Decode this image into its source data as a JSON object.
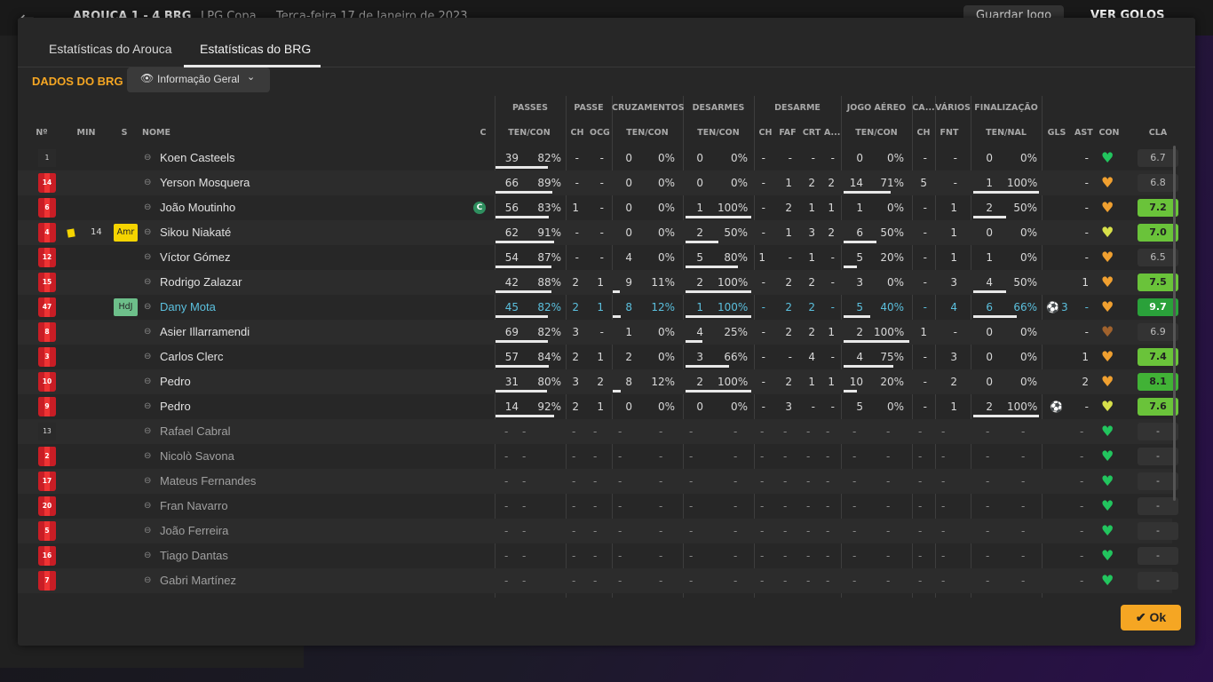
{
  "topbar": {
    "score": "AROUCA   1 - 4   BRG",
    "competition": "LPG Copa",
    "date": "Terça-feira 17 de Janeiro de 2023",
    "save": "Guardar Jogo",
    "goals": "VER GOLOS"
  },
  "tabs": [
    {
      "label": "Estatísticas do Arouca"
    },
    {
      "label": "Estatísticas do BRG"
    }
  ],
  "subtitle": "DADOS DO BRG",
  "view_dropdown": {
    "label": "Informação Geral"
  },
  "groups": [
    "PASSES",
    "PASSE",
    "CRUZAMENTOS",
    "DESARMES",
    "DESARME",
    "JOGO AÉREO",
    "CA...",
    "VÁRIOS",
    "FINALIZAÇÃO"
  ],
  "columns": [
    "Nº",
    "MIN",
    "S",
    "NOME",
    "C",
    "TEN/CON",
    "CH",
    "OCG",
    "TEN/CON",
    "TEN/CON",
    "CH",
    "FAF",
    "CRT",
    "A...",
    "TEN/CON",
    "CH",
    "FNT",
    "TEN/NAL",
    "GLS",
    "AST",
    "CON",
    "CLA"
  ],
  "rows": [
    {
      "no": "1",
      "gk": true,
      "min": "",
      "pos": "",
      "name": "Koen Casteels",
      "cap": "",
      "pt": "39",
      "pp": "82%",
      "pch": "-",
      "pocg": "-",
      "ct": "0",
      "cp": "0%",
      "dt": "0",
      "dp": "0%",
      "dch": "-",
      "faf": "-",
      "crt": "-",
      "a": "-",
      "at": "0",
      "ap": "0%",
      "ca": "-",
      "fnt": "-",
      "ft": "0",
      "fp": "0%",
      "gls": "",
      "ast": "-",
      "rating": "6.7",
      "r": 1,
      "heart": "#22c55e",
      "yc": false
    },
    {
      "no": "14",
      "min": "",
      "pos": "",
      "name": "Yerson Mosquera",
      "cap": "",
      "pt": "66",
      "pp": "89%",
      "pch": "-",
      "pocg": "-",
      "ct": "0",
      "cp": "0%",
      "dt": "0",
      "dp": "0%",
      "dch": "-",
      "faf": "1",
      "crt": "2",
      "a": "2",
      "at": "14",
      "ap": "71%",
      "ca": "5",
      "fnt": "-",
      "ft": "1",
      "fp": "100%",
      "gls": "",
      "ast": "-",
      "rating": "6.8",
      "r": 1,
      "heart": "#f0a030",
      "yc": false
    },
    {
      "no": "6",
      "min": "",
      "pos": "",
      "name": "João Moutinho",
      "cap": "C",
      "pt": "56",
      "pp": "83%",
      "pch": "1",
      "pocg": "-",
      "ct": "0",
      "cp": "0%",
      "dt": "1",
      "dp": "100%",
      "dch": "-",
      "faf": "2",
      "crt": "1",
      "a": "1",
      "at": "1",
      "ap": "0%",
      "ca": "-",
      "fnt": "1",
      "ft": "2",
      "fp": "50%",
      "gls": "",
      "ast": "-",
      "rating": "7.2",
      "r": 2,
      "heart": "#f0a030",
      "yc": false
    },
    {
      "no": "4",
      "min": "14",
      "pos": "Amr",
      "name": "Sikou Niakaté",
      "cap": "",
      "pt": "62",
      "pp": "91%",
      "pch": "-",
      "pocg": "-",
      "ct": "0",
      "cp": "0%",
      "dt": "2",
      "dp": "50%",
      "dch": "-",
      "faf": "1",
      "crt": "3",
      "a": "2",
      "at": "6",
      "ap": "50%",
      "ca": "-",
      "fnt": "1",
      "ft": "0",
      "fp": "0%",
      "gls": "",
      "ast": "-",
      "rating": "7.0",
      "r": 2,
      "heart": "#d7e04a",
      "yc": true
    },
    {
      "no": "12",
      "min": "",
      "pos": "",
      "name": "Víctor Gómez",
      "cap": "",
      "pt": "54",
      "pp": "87%",
      "pch": "-",
      "pocg": "-",
      "ct": "4",
      "cp": "0%",
      "dt": "5",
      "dp": "80%",
      "dch": "1",
      "faf": "-",
      "crt": "1",
      "a": "-",
      "at": "5",
      "ap": "20%",
      "ca": "-",
      "fnt": "1",
      "ft": "1",
      "fp": "0%",
      "gls": "",
      "ast": "-",
      "rating": "6.5",
      "r": 1,
      "heart": "#f0a030",
      "yc": false
    },
    {
      "no": "15",
      "min": "",
      "pos": "",
      "name": "Rodrigo Zalazar",
      "cap": "",
      "pt": "42",
      "pp": "88%",
      "pch": "2",
      "pocg": "1",
      "ct": "9",
      "cp": "11%",
      "dt": "2",
      "dp": "100%",
      "dch": "-",
      "faf": "2",
      "crt": "2",
      "a": "-",
      "at": "3",
      "ap": "0%",
      "ca": "-",
      "fnt": "3",
      "ft": "4",
      "fp": "50%",
      "gls": "",
      "ast": "1",
      "rating": "7.5",
      "r": 2,
      "heart": "#f0a030",
      "yc": false
    },
    {
      "no": "47",
      "min": "",
      "pos": "HdJ",
      "name": "Dany Mota",
      "cap": "",
      "pt": "45",
      "pp": "82%",
      "pch": "2",
      "pocg": "1",
      "ct": "8",
      "cp": "12%",
      "dt": "1",
      "dp": "100%",
      "dch": "-",
      "faf": "2",
      "crt": "2",
      "a": "-",
      "at": "5",
      "ap": "40%",
      "ca": "-",
      "fnt": "4",
      "ft": "6",
      "fp": "66%",
      "gls": "3",
      "ast": "-",
      "rating": "9.7",
      "r": 4,
      "heart": "#f0a030",
      "yc": false,
      "hl": true
    },
    {
      "no": "8",
      "min": "",
      "pos": "",
      "name": "Asier Illarramendi",
      "cap": "",
      "pt": "69",
      "pp": "82%",
      "pch": "3",
      "pocg": "-",
      "ct": "1",
      "cp": "0%",
      "dt": "4",
      "dp": "25%",
      "dch": "-",
      "faf": "2",
      "crt": "2",
      "a": "1",
      "at": "2",
      "ap": "100%",
      "ca": "1",
      "fnt": "-",
      "ft": "0",
      "fp": "0%",
      "gls": "",
      "ast": "-",
      "rating": "6.9",
      "r": 1,
      "heart": "#a0622d",
      "yc": false
    },
    {
      "no": "3",
      "min": "",
      "pos": "",
      "name": "Carlos Clerc",
      "cap": "",
      "pt": "57",
      "pp": "84%",
      "pch": "2",
      "pocg": "1",
      "ct": "2",
      "cp": "0%",
      "dt": "3",
      "dp": "66%",
      "dch": "-",
      "faf": "-",
      "crt": "4",
      "a": "-",
      "at": "4",
      "ap": "75%",
      "ca": "-",
      "fnt": "3",
      "ft": "0",
      "fp": "0%",
      "gls": "",
      "ast": "1",
      "rating": "7.4",
      "r": 2,
      "heart": "#f0a030",
      "yc": false
    },
    {
      "no": "10",
      "min": "",
      "pos": "",
      "name": "Pedro",
      "cap": "",
      "pt": "31",
      "pp": "80%",
      "pch": "3",
      "pocg": "2",
      "ct": "8",
      "cp": "12%",
      "dt": "2",
      "dp": "100%",
      "dch": "-",
      "faf": "2",
      "crt": "1",
      "a": "1",
      "at": "10",
      "ap": "20%",
      "ca": "-",
      "fnt": "2",
      "ft": "0",
      "fp": "0%",
      "gls": "",
      "ast": "2",
      "rating": "8.1",
      "r": 3,
      "heart": "#f0a030",
      "yc": false
    },
    {
      "no": "9",
      "min": "",
      "pos": "",
      "name": "Pedro",
      "cap": "",
      "pt": "14",
      "pp": "92%",
      "pch": "2",
      "pocg": "1",
      "ct": "0",
      "cp": "0%",
      "dt": "0",
      "dp": "0%",
      "dch": "-",
      "faf": "3",
      "crt": "-",
      "a": "-",
      "at": "5",
      "ap": "0%",
      "ca": "-",
      "fnt": "1",
      "ft": "2",
      "fp": "100%",
      "gls": "ball",
      "ast": "-",
      "rating": "7.6",
      "r": 2,
      "heart": "#d7e04a",
      "yc": false
    },
    {
      "no": "13",
      "gk": true,
      "unused": true,
      "name": "Rafael Cabral"
    },
    {
      "no": "2",
      "unused": true,
      "name": "Nicolò Savona"
    },
    {
      "no": "17",
      "unused": true,
      "name": "Mateus Fernandes"
    },
    {
      "no": "20",
      "unused": true,
      "name": "Fran Navarro"
    },
    {
      "no": "5",
      "unused": true,
      "name": "João Ferreira"
    },
    {
      "no": "16",
      "unused": true,
      "name": "Tiago Dantas"
    },
    {
      "no": "7",
      "unused": true,
      "name": "Gabri Martínez"
    }
  ],
  "ok_button": "Ok",
  "colors": {
    "accent": "#f5a623",
    "highlight": "#5bc0de",
    "morale_green": "#22c55e"
  }
}
